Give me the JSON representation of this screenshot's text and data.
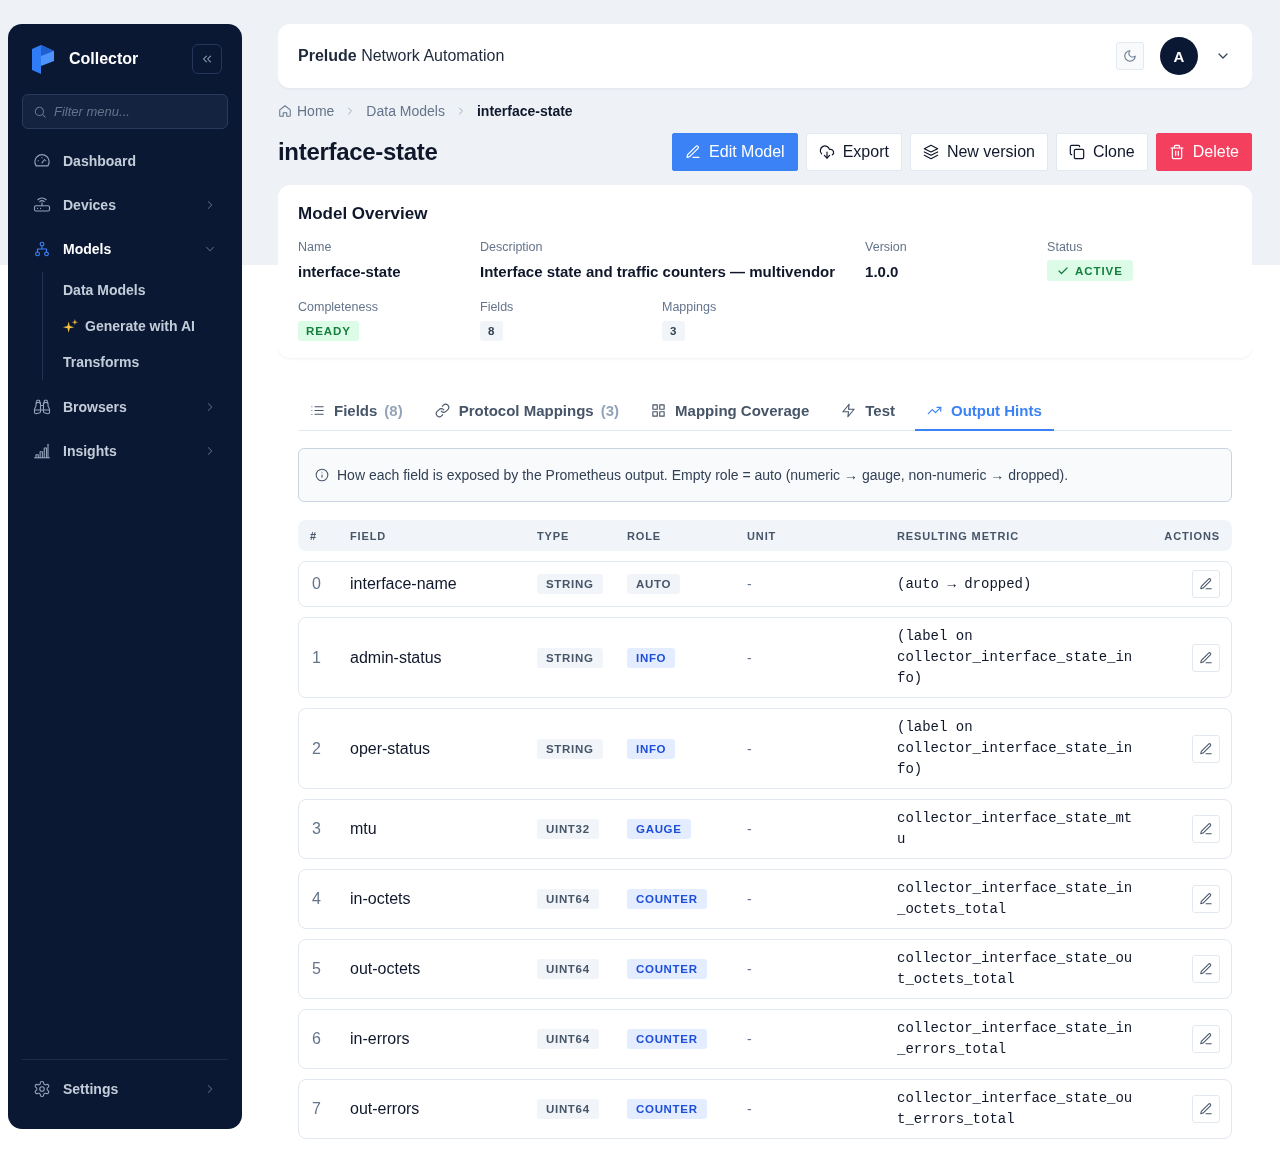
{
  "sidebar": {
    "app_name": "Collector",
    "filter": {
      "placeholder": "Filter menu..."
    },
    "items": [
      {
        "label": "Dashboard",
        "selected": false
      },
      {
        "label": "Devices",
        "selected": false,
        "expanded": false
      },
      {
        "label": "Models",
        "selected": true,
        "expanded": true,
        "children": [
          {
            "label": "Data Models",
            "kind": "link"
          },
          {
            "label": "Generate with AI",
            "kind": "ai"
          },
          {
            "label": "Transforms",
            "kind": "link"
          }
        ]
      },
      {
        "label": "Browsers",
        "selected": false,
        "expanded": false
      },
      {
        "label": "Insights",
        "selected": false,
        "expanded": false
      }
    ],
    "footer_item": {
      "label": "Settings",
      "expanded": false
    }
  },
  "header": {
    "brand": "**Prelude** Network Automation",
    "avatar": "A"
  },
  "breadcrumb": [
    {
      "label": "Home",
      "current": false
    },
    {
      "label": "Data Models",
      "current": false
    },
    {
      "label": "interface-state",
      "current": true
    }
  ],
  "page_title": "interface-state",
  "actions": [
    {
      "label": "Edit Model",
      "kind": "primary"
    },
    {
      "label": "Export",
      "kind": "default"
    },
    {
      "label": "New version",
      "kind": "default"
    },
    {
      "label": "Clone",
      "kind": "default"
    },
    {
      "label": "Delete",
      "kind": "danger"
    }
  ],
  "overview": {
    "title": "Model Overview",
    "rows": [
      {
        "items": [
          {
            "label": "Name",
            "value": "interface-state",
            "kind": "text"
          },
          {
            "label": "Description",
            "value": "Interface state and traffic counters — multivendor",
            "kind": "text"
          },
          {
            "label": "Version",
            "value": "1.0.0",
            "kind": "text"
          },
          {
            "label": "Status",
            "value": "ACTIVE",
            "kind": "status"
          }
        ]
      },
      {
        "items": [
          {
            "label": "Completeness",
            "value": "READY",
            "kind": "success"
          },
          {
            "label": "Fields",
            "value": "8",
            "kind": "count"
          },
          {
            "label": "Mappings",
            "value": "3",
            "kind": "count"
          }
        ]
      }
    ]
  },
  "tabs": [
    {
      "label": "Fields",
      "count": "(8)",
      "selected": false
    },
    {
      "label": "Protocol Mappings",
      "count": "(3)",
      "selected": false
    },
    {
      "label": "Mapping Coverage",
      "selected": false
    },
    {
      "label": "Test",
      "selected": false
    },
    {
      "label": "Output Hints",
      "selected": true
    }
  ],
  "info": "How each field is exposed by the Prometheus output. Empty role = auto (numeric → gauge, non-numeric → dropped).",
  "table": {
    "columns": [
      "#",
      "FIELD",
      "TYPE",
      "ROLE",
      "UNIT",
      "RESULTING METRIC",
      "ACTIONS"
    ],
    "rows": [
      {
        "index": "0",
        "field": "interface-name",
        "type": "STRING",
        "role": {
          "label": "AUTO",
          "kind": "auto"
        },
        "unit": "-",
        "metric": "(auto → dropped)"
      },
      {
        "index": "1",
        "field": "admin-status",
        "type": "STRING",
        "role": {
          "label": "INFO",
          "kind": "set"
        },
        "unit": "-",
        "metric": "(label on collector_interface_state_info)"
      },
      {
        "index": "2",
        "field": "oper-status",
        "type": "STRING",
        "role": {
          "label": "INFO",
          "kind": "set"
        },
        "unit": "-",
        "metric": "(label on collector_interface_state_info)"
      },
      {
        "index": "3",
        "field": "mtu",
        "type": "UINT32",
        "role": {
          "label": "GAUGE",
          "kind": "set"
        },
        "unit": "-",
        "metric": "collector_interface_state_mtu"
      },
      {
        "index": "4",
        "field": "in-octets",
        "type": "UINT64",
        "role": {
          "label": "COUNTER",
          "kind": "set"
        },
        "unit": "-",
        "metric": "collector_interface_state_in_octets_total"
      },
      {
        "index": "5",
        "field": "out-octets",
        "type": "UINT64",
        "role": {
          "label": "COUNTER",
          "kind": "set"
        },
        "unit": "-",
        "metric": "collector_interface_state_out_octets_total"
      },
      {
        "index": "6",
        "field": "in-errors",
        "type": "UINT64",
        "role": {
          "label": "COUNTER",
          "kind": "set"
        },
        "unit": "-",
        "metric": "collector_interface_state_in_errors_total"
      },
      {
        "index": "7",
        "field": "out-errors",
        "type": "UINT64",
        "role": {
          "label": "COUNTER",
          "kind": "set"
        },
        "unit": "-",
        "metric": "collector_interface_state_out_errors_total"
      }
    ]
  }
}
